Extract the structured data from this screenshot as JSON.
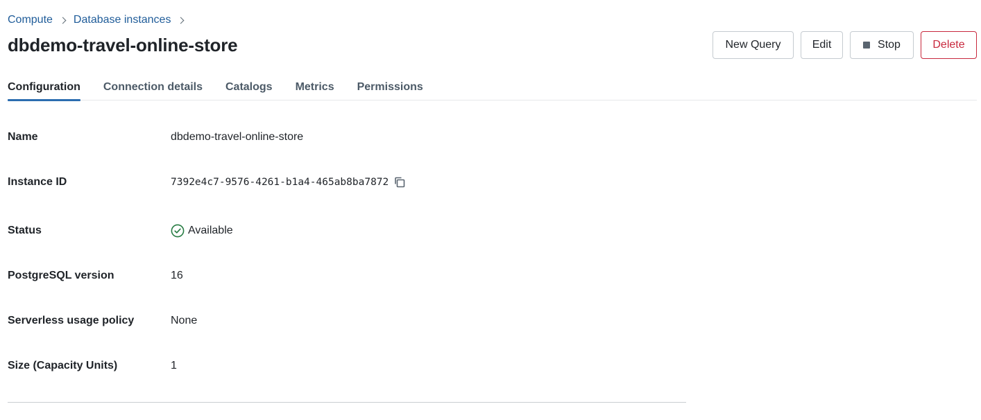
{
  "breadcrumb": {
    "items": [
      "Compute",
      "Database instances"
    ]
  },
  "page": {
    "title": "dbdemo-travel-online-store"
  },
  "actions": {
    "new_query": "New Query",
    "edit": "Edit",
    "stop": "Stop",
    "delete": "Delete"
  },
  "tabs": [
    "Configuration",
    "Connection details",
    "Catalogs",
    "Metrics",
    "Permissions"
  ],
  "details": {
    "name": {
      "label": "Name",
      "value": "dbdemo-travel-online-store"
    },
    "instance_id": {
      "label": "Instance ID",
      "value": "7392e4c7-9576-4261-b1a4-465ab8ba7872"
    },
    "status": {
      "label": "Status",
      "value": "Available"
    },
    "postgres_version": {
      "label": "PostgreSQL version",
      "value": "16"
    },
    "usage_policy": {
      "label": "Serverless usage policy",
      "value": "None"
    },
    "size": {
      "label": "Size (Capacity Units)",
      "value": "1"
    }
  },
  "colors": {
    "link": "#1f5c99",
    "tab_active_underline": "#2b6db0",
    "delete": "#c8283d",
    "status_ok": "#277c43"
  },
  "icons": {
    "breadcrumb_separator": "chevron-right-icon",
    "stop": "stop-square-icon",
    "copy": "copy-icon",
    "status": "check-circle-icon"
  }
}
